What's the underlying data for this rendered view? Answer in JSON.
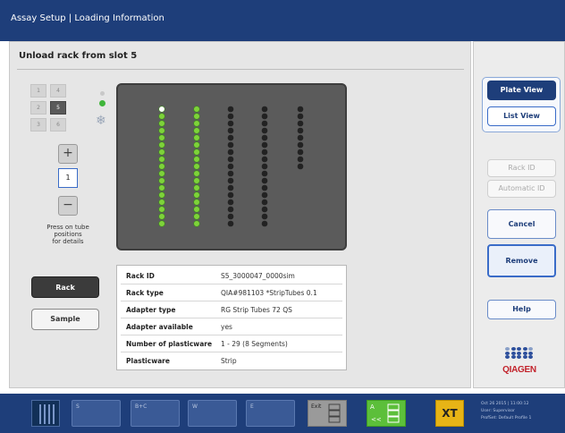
{
  "header": {
    "title": "Assay Setup | Loading Information"
  },
  "main": {
    "title": "Unload rack from slot 5",
    "slot_grid": [
      "1",
      "4",
      "2",
      "5",
      "3",
      "6"
    ],
    "active_slot": "5",
    "position_value": "1",
    "plus_label": "+",
    "minus_label": "−",
    "hint_lines": [
      "Press on tube",
      "positions",
      "for details"
    ],
    "rack_button": "Rack",
    "sample_button": "Sample",
    "plate": {
      "columns": [
        {
          "filled": 17,
          "empty": 0,
          "first_highlighted": true
        },
        {
          "filled": 17,
          "empty": 0,
          "first_highlighted": false
        },
        {
          "filled": 0,
          "empty": 17,
          "first_highlighted": false
        },
        {
          "filled": 0,
          "empty": 17,
          "first_highlighted": false
        },
        {
          "filled": 0,
          "empty": 9,
          "first_highlighted": false
        }
      ],
      "colors": {
        "filled": "#7ed23a",
        "empty": "#222222",
        "highlight": "#ffffff"
      }
    },
    "info": [
      {
        "key": "Rack ID",
        "value": "S5_3000047_0000sim"
      },
      {
        "key": "Rack type",
        "value": "QIA#981103 *StripTubes 0.1"
      },
      {
        "key": "Adapter type",
        "value": "RG Strip Tubes 72 QS"
      },
      {
        "key": "Adapter available",
        "value": "yes"
      },
      {
        "key": "Number of plasticware",
        "value": "1 - 29 (8 Segments)"
      },
      {
        "key": "Plasticware",
        "value": "Strip"
      }
    ]
  },
  "sidebar": {
    "plate_view": "Plate View",
    "list_view": "List View",
    "rack_id": "Rack ID",
    "automatic_id": "Automatic ID",
    "cancel": "Cancel",
    "remove": "Remove",
    "help": "Help",
    "logo_text": "QIAGEN"
  },
  "taskbar": {
    "slots": [
      "S",
      "B+C",
      "W",
      "E"
    ],
    "exit": "Exit",
    "a": "A",
    "a_arrows": "<<",
    "xt": "XT",
    "info_lines": [
      "Oct 26 2015 | 11:00:12",
      "User:        Supervisor",
      "ProfSet:   Default Profile 1"
    ]
  },
  "colors": {
    "accent": "#1e3e7a",
    "ok": "#5cbf3a",
    "selected_border": "#3a6cc8"
  }
}
